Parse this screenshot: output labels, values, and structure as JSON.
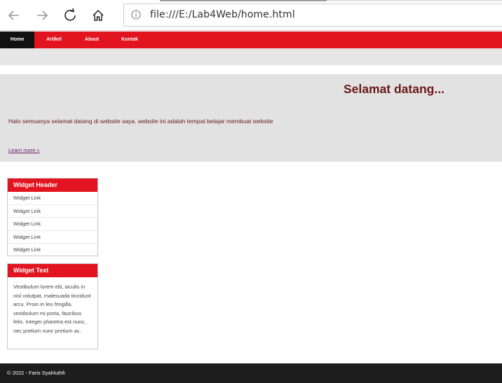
{
  "browser": {
    "url": "file:///E:/Lab4Web/home.html"
  },
  "nav": {
    "items": [
      "Home",
      "Artikel",
      "About",
      "Kontak"
    ],
    "active": "Home"
  },
  "hero": {
    "title": "Selamat datang...",
    "text": "Halo semuanya selamat datang di website saya. website ini adalah tempat belajar membuat website",
    "link": "Learn more »"
  },
  "widgets": {
    "header": {
      "title": "Widget Header",
      "links": [
        "Widget Link",
        "Widget Link",
        "Widget Link",
        "Widget Link",
        "Widget Link"
      ]
    },
    "text": {
      "title": "Widget Text",
      "body": "Vestibulum lorem elit, iaculis in nisl volutpat, malesuada tincidunt arcu. Proin in leo fringilla, vestibulum mi porta, faucibus felis. Integer pharetra est nunc, nec pretium nunc pretium ac."
    }
  },
  "footer": {
    "text": "© 2022 - Faris Syahluthfi"
  },
  "colors": {
    "accent": "#e1141f",
    "active_nav": "#111111",
    "heading": "#6b1a1a",
    "footer": "#1d1d1d"
  }
}
